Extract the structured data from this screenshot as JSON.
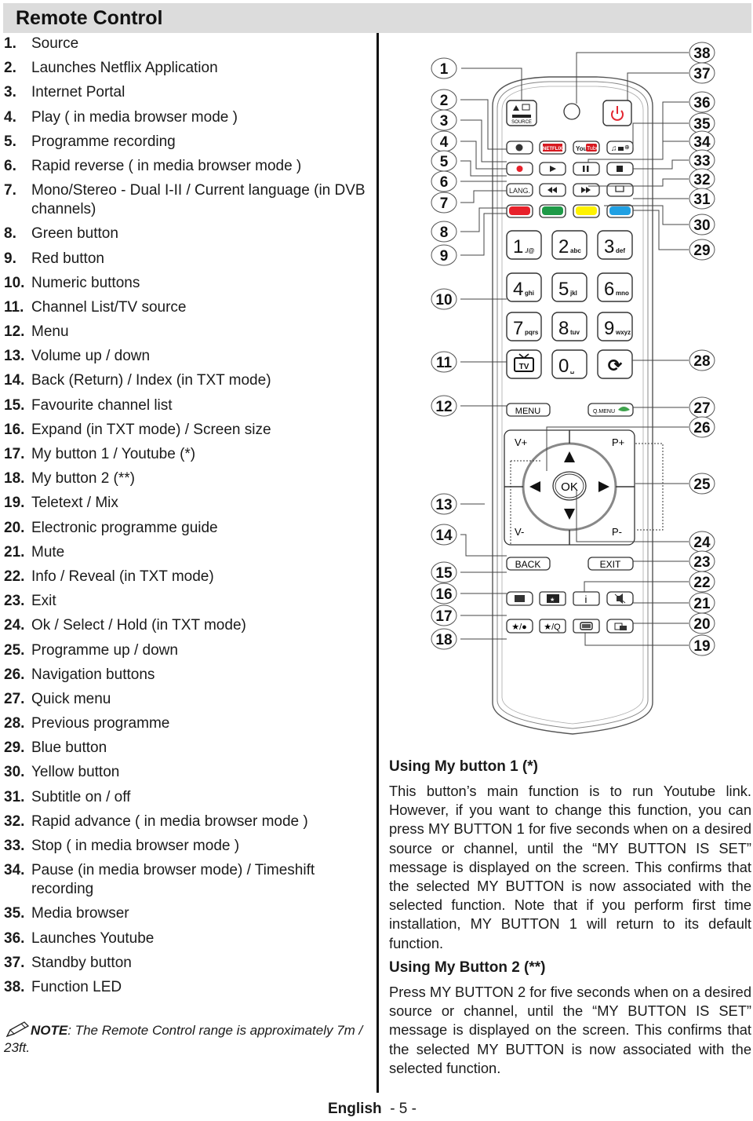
{
  "page": {
    "title": "Remote Control",
    "footer_language": "English",
    "footer_page": "- 5 -"
  },
  "items": [
    {
      "num": "1.",
      "text": "Source"
    },
    {
      "num": "2.",
      "text": "Launches Netflix Application"
    },
    {
      "num": "3.",
      "text": "Internet Portal"
    },
    {
      "num": "4.",
      "text": "Play ( in media browser mode )"
    },
    {
      "num": "5.",
      "text": "Programme recording"
    },
    {
      "num": "6.",
      "text": "Rapid reverse ( in media browser mode )"
    },
    {
      "num": "7.",
      "text": "Mono/Stereo - Dual I-II / Current language (in DVB channels)"
    },
    {
      "num": "8.",
      "text": "Green button"
    },
    {
      "num": "9.",
      "text": "Red button"
    },
    {
      "num": "10.",
      "text": "Numeric buttons"
    },
    {
      "num": "11.",
      "text": "Channel List/TV source"
    },
    {
      "num": "12.",
      "text": "Menu"
    },
    {
      "num": "13.",
      "text": "Volume up / down"
    },
    {
      "num": "14.",
      "text": "Back (Return) / Index (in TXT mode)"
    },
    {
      "num": "15.",
      "text": "Favourite channel list"
    },
    {
      "num": "16.",
      "text": "Expand (in TXT mode) / Screen size"
    },
    {
      "num": "17.",
      "text": "My button 1 / Youtube (*)"
    },
    {
      "num": "18.",
      "text": "My button 2 (**)"
    },
    {
      "num": "19.",
      "text": "Teletext / Mix"
    },
    {
      "num": "20.",
      "text": "Electronic programme guide"
    },
    {
      "num": "21.",
      "text": "Mute"
    },
    {
      "num": "22.",
      "text": "Info / Reveal (in TXT mode)"
    },
    {
      "num": "23.",
      "text": "Exit"
    },
    {
      "num": "24.",
      "text": "Ok / Select / Hold (in TXT mode)"
    },
    {
      "num": "25.",
      "text": "Programme up / down"
    },
    {
      "num": "26.",
      "text": "Navigation buttons"
    },
    {
      "num": "27.",
      "text": "Quick menu"
    },
    {
      "num": "28.",
      "text": "Previous programme"
    },
    {
      "num": "29.",
      "text": "Blue button"
    },
    {
      "num": "30.",
      "text": "Yellow button"
    },
    {
      "num": "31.",
      "text": "Subtitle on / off"
    },
    {
      "num": "32.",
      "text": "Rapid advance ( in media browser mode )"
    },
    {
      "num": "33.",
      "text": "Stop ( in media browser mode )"
    },
    {
      "num": "34.",
      "text": "Pause (in media browser mode) / Timeshift recording"
    },
    {
      "num": "35.",
      "text": "Media browser"
    },
    {
      "num": "36.",
      "text": "Launches Youtube"
    },
    {
      "num": "37.",
      "text": "Standby button"
    },
    {
      "num": "38.",
      "text": "Function LED"
    }
  ],
  "note": {
    "label": "NOTE",
    "text": ": The Remote Control range is approximately 7m / 23ft."
  },
  "my_button_1": {
    "heading": "Using My button 1 (*)",
    "body": "This button’s main function is to run Youtube link. However, if you want to change this function, you can press MY BUTTON 1  for five seconds when on a desired source or channel, until the  “MY BUTTON IS SET” message is displayed on the  screen. This confirms that the selected MY BUTTON is now associated with the selected function. Note that if you perform first time installation, MY BUTTON 1 will return to its default function."
  },
  "my_button_2": {
    "heading": "Using My Button 2 (**)",
    "body": "Press MY BUTTON 2  for five seconds when on a desired source or channel, until the  “MY BUTTON IS SET” message is displayed on the screen. This confirms that the selected MY BUTTON is now associated with the selected function."
  },
  "remote": {
    "buttons": {
      "source": "SOURCE",
      "netflix": "NETFLIX",
      "youtube_you": "You",
      "youtube_tube": "Tube",
      "lang": "LANG.",
      "menu": "MENU",
      "qmenu": "Q.MENU",
      "vplus": "V+",
      "vminus": "V-",
      "pplus": "P+",
      "pminus": "P-",
      "ok": "OK",
      "back": "BACK",
      "exit": "EXIT",
      "info": "i",
      "fav1": "★/●",
      "fav2": "★/Q"
    },
    "numeric": [
      {
        "digit": "1",
        "sub": "./@"
      },
      {
        "digit": "2",
        "sub": "abc"
      },
      {
        "digit": "3",
        "sub": "def"
      },
      {
        "digit": "4",
        "sub": "ghi"
      },
      {
        "digit": "5",
        "sub": "jkl"
      },
      {
        "digit": "6",
        "sub": "mno"
      },
      {
        "digit": "7",
        "sub": "pqrs"
      },
      {
        "digit": "8",
        "sub": "tuv"
      },
      {
        "digit": "9",
        "sub": "wxyz"
      },
      {
        "digit": "0",
        "sub": "␣"
      }
    ],
    "colors": {
      "red": "#e8202a",
      "green": "#1e9a47",
      "yellow": "#fff200",
      "blue": "#1fa0e3",
      "power": "#e32630",
      "netflix": "#d71920"
    },
    "callouts_left": [
      "1",
      "2",
      "3",
      "4",
      "5",
      "6",
      "7",
      "8",
      "9",
      "10",
      "11",
      "12",
      "13",
      "14",
      "15",
      "16",
      "17",
      "18"
    ],
    "callouts_right": [
      "38",
      "37",
      "36",
      "35",
      "34",
      "33",
      "32",
      "31",
      "30",
      "29",
      "28",
      "27",
      "26",
      "25",
      "24",
      "23",
      "22",
      "21",
      "20",
      "19"
    ]
  }
}
